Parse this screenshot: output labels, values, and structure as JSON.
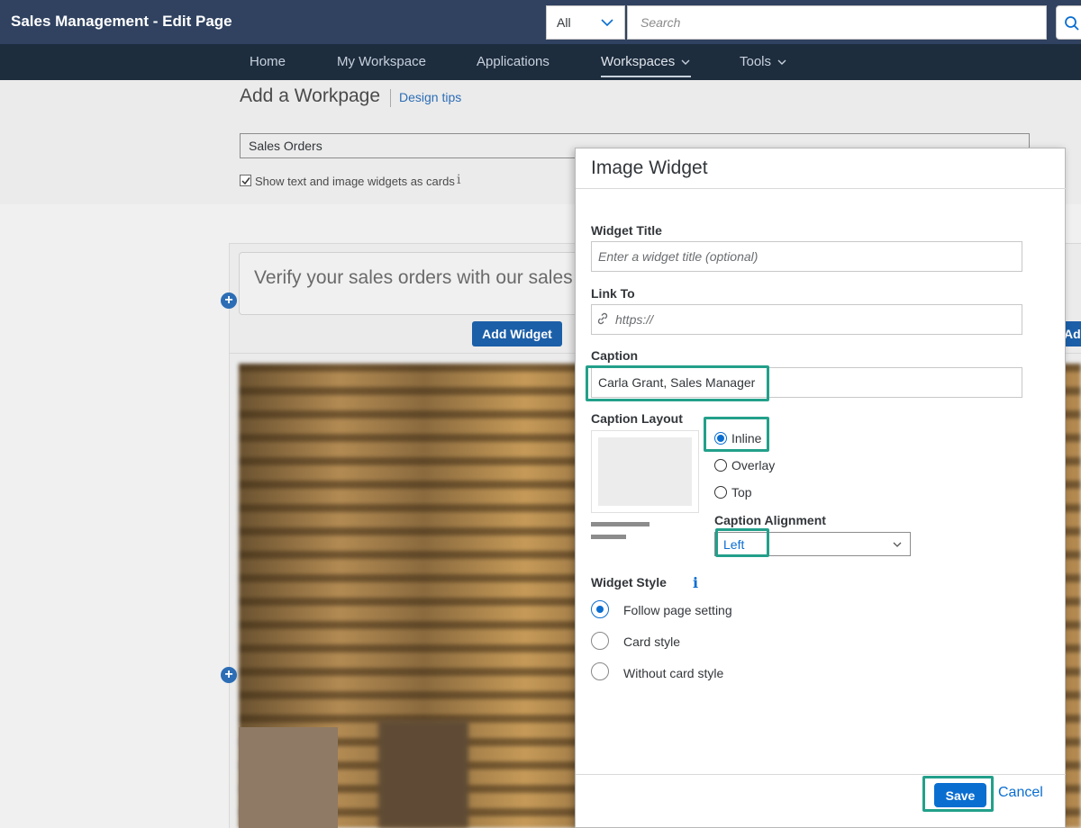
{
  "shell": {
    "title": "Sales Management - Edit Page",
    "scope_value": "All",
    "search_placeholder": "Search"
  },
  "nav": {
    "items": [
      {
        "label": "Home"
      },
      {
        "label": "My Workspace"
      },
      {
        "label": "Applications"
      },
      {
        "label": "Workspaces"
      },
      {
        "label": "Tools"
      }
    ]
  },
  "page": {
    "title": "Add a Workpage",
    "design_tips": "Design tips",
    "page_name": "Sales Orders",
    "cards_checkbox_label": "Show text and image widgets as cards",
    "cards_checkbox_checked": true
  },
  "canvas": {
    "text_widget_text": "Verify your sales orders with our sales m",
    "add_widget_label": "Add Widget",
    "add_widget_label_2": "Ad"
  },
  "dialog": {
    "title": "Image Widget",
    "widget_title_label": "Widget Title",
    "widget_title_placeholder": "Enter a widget title (optional)",
    "link_to_label": "Link To",
    "link_to_placeholder": "https://",
    "caption_label": "Caption",
    "caption_value": "Carla Grant, Sales Manager",
    "caption_layout_label": "Caption Layout",
    "layout_options": [
      {
        "label": "Inline",
        "checked": true
      },
      {
        "label": "Overlay",
        "checked": false
      },
      {
        "label": "Top",
        "checked": false
      }
    ],
    "caption_alignment_label": "Caption Alignment",
    "caption_alignment_value": "Left",
    "widget_style_label": "Widget Style",
    "style_options": [
      {
        "label": "Follow page setting",
        "checked": true
      },
      {
        "label": "Card style",
        "checked": false
      },
      {
        "label": "Without card style",
        "checked": false
      }
    ],
    "save_label": "Save",
    "cancel_label": "Cancel"
  },
  "colors": {
    "shell_bg": "#304260",
    "nav_bg": "#1d2d3e",
    "accent": "#0a6ed1",
    "highlight": "#23a08a"
  }
}
